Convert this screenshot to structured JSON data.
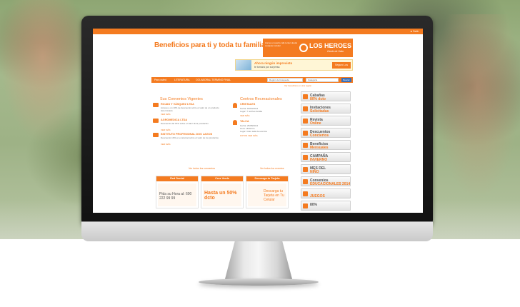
{
  "site": {
    "topbar_text": "● Salir",
    "headline": "Beneficios para ti y toda tu familia",
    "logo": {
      "brand": "LOS HEROES",
      "tagline": "Gente de Valor",
      "small_copy": "Llame a nuestro call center desde cualquier celular"
    },
    "promo_banner": {
      "line1": "Ahora ningún imprevisto",
      "line2": "te tomará por sorpresa",
      "badge": "Seguro Los Héroes"
    },
    "nav": {
      "items": [
        "Para usted",
        "LITERATURA",
        "COLABORAL TERMINO FINAL"
      ],
      "select1": "Región de búsqueda",
      "select2": "Categoría",
      "go_label": "Buscar Beneficio",
      "sub_link": "Ver beneficios en otra región"
    },
    "convenios": {
      "title": "Sus Convenios Vigentes",
      "items": [
        {
          "name": "ROJAS Y VÁSQUEZ LTDA",
          "desc": "Acceso a un 10% de descuento sobre el valor de un producto determinado",
          "more": "VER MÁS"
        },
        {
          "name": "AGROMEDICA LTDA",
          "desc": "Descuento del 15% sobre el valor de la prestación",
          "more": "VER MÁS"
        },
        {
          "name": "INSTITUTO PROFESIONAL DOS LAGOS",
          "desc": "Descuento 10% en el arancel sobre el valor de los productos",
          "more": "VER MÁS"
        }
      ]
    },
    "centros": {
      "title": "Centros Recreacionales",
      "items": [
        {
          "name": "CRISTALES",
          "lines": [
            "Fecha: 18/04/2014",
            "Lugar: 7 noches familia"
          ],
          "more": "VER MÁS"
        },
        {
          "name": "TALCA",
          "lines": [
            "Fecha: 25/08/2014",
            "Hora: 18:00 hrs",
            "Lugar: Gran sala de eventos"
          ],
          "more": "FOTOS VER MÁS"
        }
      ]
    },
    "foot_links": {
      "left": "Ver todos los convenios",
      "right": "Ver todos los eventos"
    },
    "promo_cards": [
      {
        "header": "Red Dental",
        "body": "Pida su Hora al: 600 222 99 99"
      },
      {
        "header": "Cruz Verde",
        "body": "Hasta un 50% dcto"
      },
      {
        "header": "Descarga tu Tarjeta",
        "body": "Descarga tu Tarjeta en Tu Celular"
      }
    ],
    "sidebar": [
      {
        "label": "Cabañas",
        "accent": "80% dcto",
        "icon": "cabin-icon"
      },
      {
        "label": "Invitaciones",
        "accent": "Solicitadas",
        "icon": "ticket-icon"
      },
      {
        "label": "Revista",
        "accent": "Online",
        "icon": "magazine-icon"
      },
      {
        "label": "Descuentos",
        "accent": "Conciertos",
        "icon": "music-icon"
      },
      {
        "label": "Beneficios",
        "accent": "Mensuales",
        "icon": "gift-icon"
      },
      {
        "label": "CAMPAÑA",
        "accent": "INVIERNO",
        "icon": "snow-icon"
      },
      {
        "label": "MES DEL",
        "accent": "NIÑO",
        "icon": "child-icon"
      },
      {
        "label": "Convenios",
        "accent": "EDUCACIONALES 2014",
        "icon": "education-icon"
      },
      {
        "label": "",
        "accent": "JUEGOS",
        "icon": "games-icon"
      },
      {
        "label": "80%",
        "accent": "",
        "icon": "percent-icon"
      }
    ],
    "colors": {
      "brand_orange": "#f47b20",
      "link_blue": "#3b6fb6"
    }
  }
}
